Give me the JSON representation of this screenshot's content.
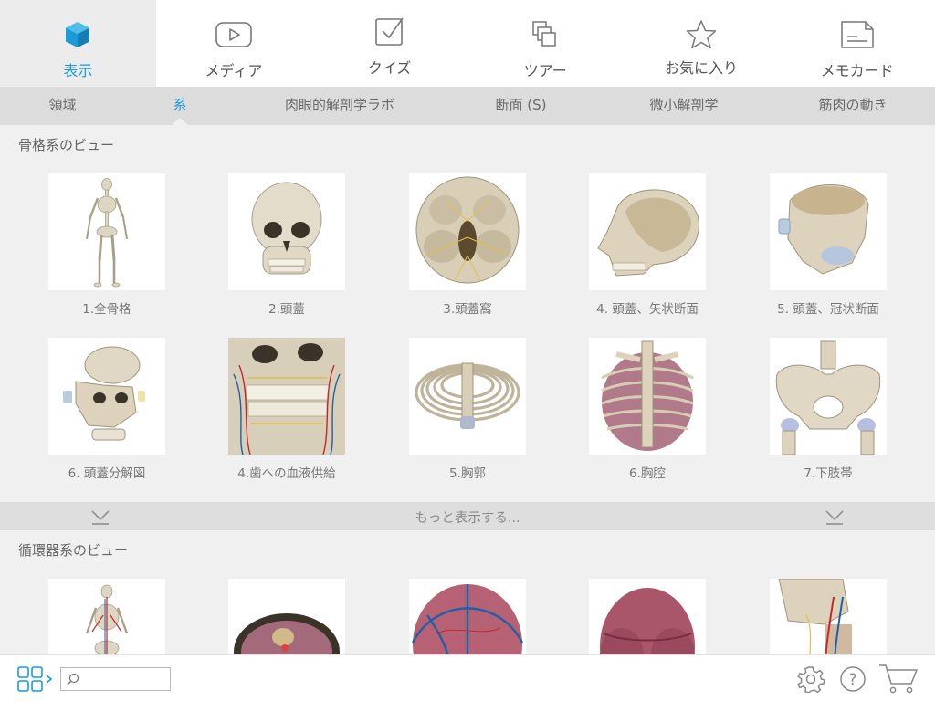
{
  "toolbar": {
    "items": [
      {
        "label": "表示",
        "icon": "cube-icon",
        "active": true
      },
      {
        "label": "メディア",
        "icon": "play-icon",
        "active": false
      },
      {
        "label": "クイズ",
        "icon": "checkbox-icon",
        "active": false
      },
      {
        "label": "ツアー",
        "icon": "layers-icon",
        "active": false
      },
      {
        "label": "お気に入り",
        "icon": "star-icon",
        "active": false
      },
      {
        "label": "メモカード",
        "icon": "notecard-icon",
        "active": false
      }
    ],
    "accent_color": "#1a9ad6"
  },
  "subtabs": {
    "items": [
      {
        "label": "領域"
      },
      {
        "label": "系"
      },
      {
        "label": "肉眼的解剖学ラボ"
      },
      {
        "label": "断面 (S)"
      },
      {
        "label": "微小解剖学"
      },
      {
        "label": "筋肉の動き"
      }
    ],
    "active_index": 1
  },
  "skeletal": {
    "title": "骨格系のビュー",
    "items": [
      {
        "caption": "1.全骨格"
      },
      {
        "caption": "2.頭蓋"
      },
      {
        "caption": "3.頭蓋窩"
      },
      {
        "caption": "4. 頭蓋、矢状断面"
      },
      {
        "caption": "5. 頭蓋、冠状断面"
      },
      {
        "caption": "6. 頭蓋分解図"
      },
      {
        "caption": "4.歯への血液供給"
      },
      {
        "caption": "5.胸郭"
      },
      {
        "caption": "6.胸腔"
      },
      {
        "caption": "7.下肢帯"
      }
    ]
  },
  "more": {
    "label": "もっと表示する..."
  },
  "circulatory": {
    "title": "循環器系のビュー"
  },
  "bottombar": {
    "search_placeholder": "",
    "icons": [
      "grid-menu-icon",
      "search-icon",
      "settings-gear-icon",
      "help-icon",
      "cart-icon"
    ]
  }
}
